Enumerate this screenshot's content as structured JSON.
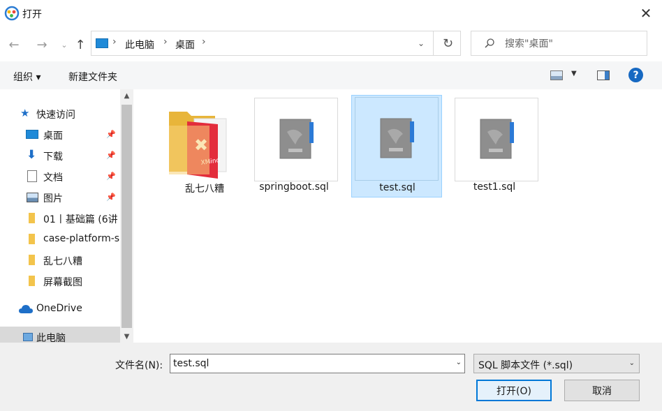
{
  "window": {
    "title": "打开"
  },
  "address": {
    "crumbs": [
      "此电脑",
      "桌面"
    ]
  },
  "search": {
    "placeholder": "搜索\"桌面\""
  },
  "toolbar": {
    "organize": "组织 ▾",
    "new_folder": "新建文件夹",
    "help": "?"
  },
  "sidebar": {
    "items": [
      {
        "label": "快速访问",
        "icon": "star-icon"
      },
      {
        "label": "桌面",
        "icon": "desktop-icon",
        "pinned": true
      },
      {
        "label": "下载",
        "icon": "download-icon",
        "pinned": true
      },
      {
        "label": "文档",
        "icon": "document-icon",
        "pinned": true
      },
      {
        "label": "图片",
        "icon": "picture-icon",
        "pinned": true
      },
      {
        "label": "01丨基础篇 (6讲",
        "icon": "folder-icon"
      },
      {
        "label": "case-platform-s",
        "icon": "folder-icon"
      },
      {
        "label": "乱七八糟",
        "icon": "folder-icon"
      },
      {
        "label": "屏幕截图",
        "icon": "folder-icon"
      },
      {
        "label": "OneDrive",
        "icon": "cloud-icon"
      },
      {
        "label": "此电脑",
        "icon": "computer-icon",
        "selected": true
      }
    ]
  },
  "files": [
    {
      "name": "乱七八糟",
      "type": "folder"
    },
    {
      "name": "springboot.sql",
      "type": "sql"
    },
    {
      "name": "test.sql",
      "type": "sql",
      "selected": true
    },
    {
      "name": "test1.sql",
      "type": "sql"
    }
  ],
  "bottom": {
    "filename_label": "文件名(N):",
    "filename_value": "test.sql",
    "filetype_value": "SQL 脚本文件 (*.sql)",
    "open_label": "打开(O)",
    "cancel_label": "取消"
  },
  "colors": {
    "accent": "#0078d7",
    "selection": "#cce8ff",
    "toolbar_bg": "#f5f6f7"
  }
}
